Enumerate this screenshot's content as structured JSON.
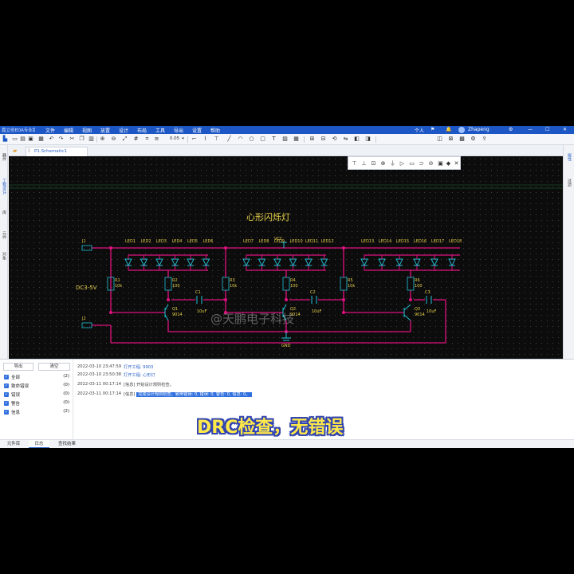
{
  "app": {
    "logo_text": "嘉立创EDA专业版"
  },
  "menus": [
    "文件",
    "编辑",
    "视图",
    "放置",
    "设计",
    "布局",
    "工具",
    "导出",
    "设置",
    "帮助"
  ],
  "top_right": {
    "mode": "个人",
    "user": "Zhapeng"
  },
  "toolbar": {
    "zoom_value": "0.05"
  },
  "document_tab": {
    "label": "P1.Schematic1"
  },
  "left_rail": [
    "器件",
    "工程设计",
    "库",
    "元件",
    "对象"
  ],
  "right_rail": [
    "属性",
    "过滤"
  ],
  "schematic": {
    "title": "心形闪烁灯",
    "connectors": [
      "J1",
      "J2"
    ],
    "supply_label": "DC3-5V",
    "vcc_label": "VCC",
    "gnd_label": "GND",
    "led_labels_group1": [
      "LED1",
      "LED2",
      "LED3",
      "LED4",
      "LED5",
      "LED6"
    ],
    "led_labels_group2": [
      "LED7",
      "LED8",
      "LED9",
      "LED10",
      "LED11",
      "LED12"
    ],
    "led_labels_group3": [
      "LED13",
      "LED14",
      "LED15",
      "LED16",
      "LED17",
      "LED18"
    ],
    "resistors": [
      {
        "ref": "R1",
        "val": "10k"
      },
      {
        "ref": "R2",
        "val": "100"
      },
      {
        "ref": "R3",
        "val": "10k"
      },
      {
        "ref": "R4",
        "val": "100"
      },
      {
        "ref": "R5",
        "val": "10k"
      },
      {
        "ref": "R6",
        "val": "100"
      }
    ],
    "capacitors": [
      {
        "ref": "C1",
        "val": "10uF"
      },
      {
        "ref": "C2",
        "val": "10uF"
      },
      {
        "ref": "C3",
        "val": "10uF"
      }
    ],
    "transistors": [
      {
        "ref": "Q1",
        "val": "9014"
      },
      {
        "ref": "Q2",
        "val": "9014"
      },
      {
        "ref": "Q3",
        "val": "9014"
      }
    ]
  },
  "watermark": "@天鹏电子科技",
  "filter_panel": {
    "export_button": "导出",
    "clear_button": "清空",
    "items": [
      {
        "label": "全部",
        "count": "(2)"
      },
      {
        "label": "致命错误",
        "count": "(0)"
      },
      {
        "label": "错误",
        "count": "(0)"
      },
      {
        "label": "警告",
        "count": "(0)"
      },
      {
        "label": "信息",
        "count": "(2)"
      }
    ]
  },
  "log": [
    {
      "time": "2022-03-10 23:47:59",
      "prefix": "",
      "text": "打开工程: 9903",
      "link": true,
      "highlight": false
    },
    {
      "time": "2022-03-10 23:50:38",
      "prefix": "",
      "text": "打开工程: 心形灯",
      "link": true,
      "highlight": false
    },
    {
      "time": "2022-03-11 00:17:14",
      "prefix": "[信息]",
      "text": "开始设计规则检查。",
      "link": false,
      "highlight": false
    },
    {
      "time": "2022-03-11 00:17:14",
      "prefix": "[信息]",
      "text": "完成设计规则检查。致命错误: 0, 错误: 0, 警告: 0, 信息: 0。",
      "link": false,
      "highlight": true
    }
  ],
  "bottom_tabs": [
    "元件库",
    "日志",
    "查找结果"
  ],
  "caption": "DRC检查，无错误",
  "colors": {
    "wire": "#e0117f",
    "component": "#22c2d8",
    "label": "#e9d24a",
    "accent": "#1d57c5"
  }
}
